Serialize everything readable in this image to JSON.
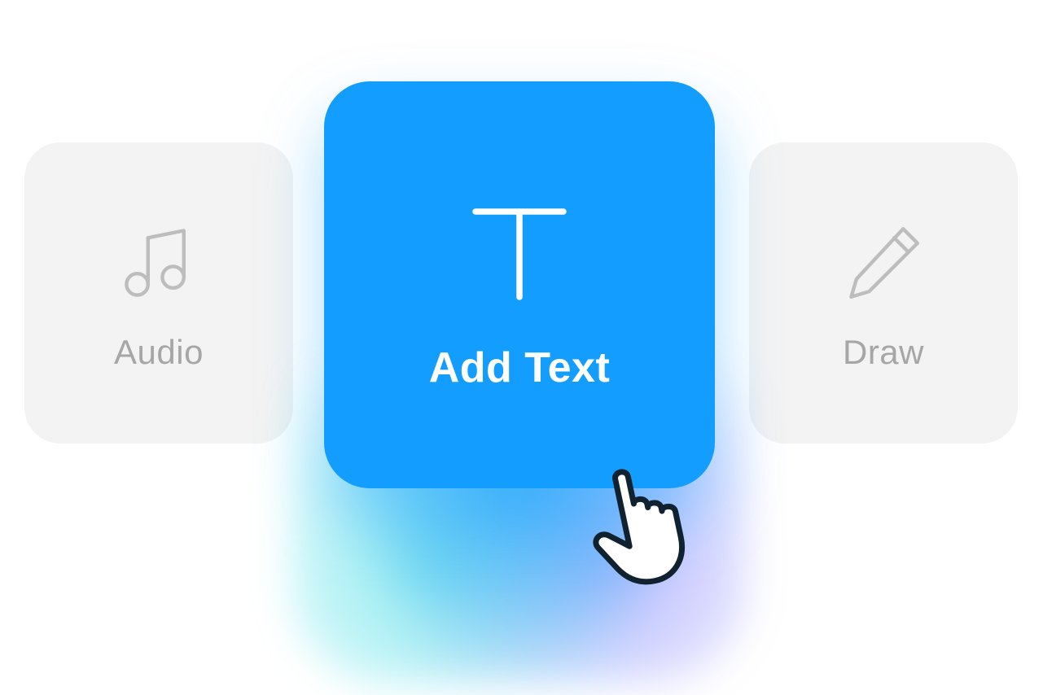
{
  "tiles": {
    "audio": {
      "label": "Audio",
      "icon": "music-note-icon"
    },
    "add_text": {
      "label": "Add Text",
      "icon": "text-t-icon"
    },
    "draw": {
      "label": "Draw",
      "icon": "pencil-icon"
    }
  },
  "colors": {
    "accent": "#129dff",
    "side_bg": "#f3f3f3",
    "side_fg": "#a6a6a6",
    "center_fg": "#ffffff"
  },
  "selected_tile": "add_text",
  "pointer_icon": "hand-pointer-icon"
}
